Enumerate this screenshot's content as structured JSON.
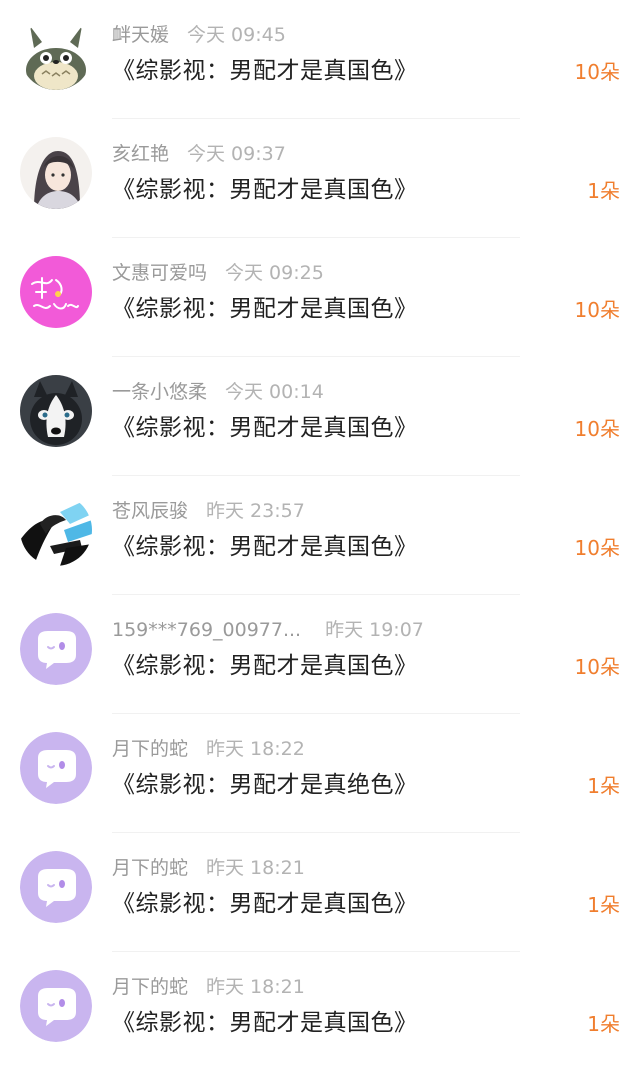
{
  "accent_color": "#f07e2e",
  "rows": [
    {
      "name": "衅天媛",
      "time": "今天 09:45",
      "title": "《综影视：男配才是真国色》",
      "count": "10朵",
      "avatar": "totoro-avatar"
    },
    {
      "name": "亥红艳",
      "time": "今天 09:37",
      "title": "《综影视：男配才是真国色》",
      "count": "1朵",
      "avatar": "anime-portrait-avatar"
    },
    {
      "name": "文惠可爱吗",
      "time": "今天 09:25",
      "title": "《综影视：男配才是真国色》",
      "count": "10朵",
      "avatar": "pink-text-avatar"
    },
    {
      "name": "一条小悠柔",
      "time": "今天 00:14",
      "title": "《综影视：男配才是真国色》",
      "count": "10朵",
      "avatar": "husky-avatar"
    },
    {
      "name": "苍风辰骏",
      "time": "昨天 23:57",
      "title": "《综影视：男配才是真国色》",
      "count": "10朵",
      "avatar": "anime-sketch-avatar"
    },
    {
      "name": "159***769_00977...",
      "time": "昨天 19:07",
      "title": "《综影视：男配才是真国色》",
      "count": "10朵",
      "avatar": "default-chat-avatar"
    },
    {
      "name": "月下的蛇",
      "time": "昨天 18:22",
      "title": "《综影视：男配才是真绝色》",
      "count": "1朵",
      "avatar": "default-chat-avatar"
    },
    {
      "name": "月下的蛇",
      "time": "昨天 18:21",
      "title": "《综影视：男配才是真国色》",
      "count": "1朵",
      "avatar": "default-chat-avatar"
    },
    {
      "name": "月下的蛇",
      "time": "昨天 18:21",
      "title": "《综影视：男配才是真国色》",
      "count": "1朵",
      "avatar": "default-chat-avatar"
    }
  ]
}
